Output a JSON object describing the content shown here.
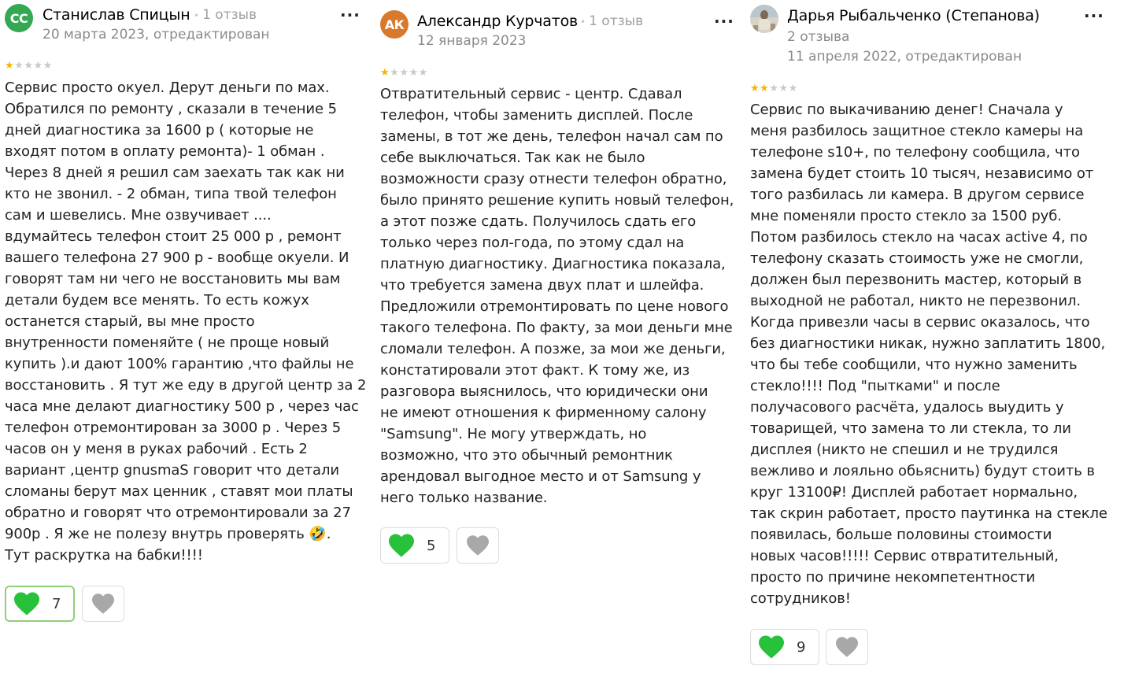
{
  "colors": {
    "heart_active": "#27c13a",
    "heart_inactive": "#a8a8a8",
    "star_filled": "#f6b400",
    "star_empty": "#c9c9c9"
  },
  "reviews": [
    {
      "avatar_initials": "СС",
      "avatar_color": "#34a853",
      "author": "Станислав Спицын",
      "review_count": "1 отзыв",
      "date": "20 марта 2023, отредактирован",
      "rating": 1,
      "text": "Сервис просто окуел. Дерут деньги по мах.\nОбратился по ремонту , сказали в течение 5\nдней диагностика за 1600 р ( которые не\nвходят потом в оплату ремонта)- 1 обман .\nЧерез 8 дней я решил сам заехать так как ни\nкто не звонил. - 2 обман, типа твой телефон\nсам и шевелись. Мне озвучивает ....\nвдумайтесь телефон стоит 25 000 р , ремонт\nвашего телефона 27 900 р - вообще окуели. И\nговорят там ни чего не восстановить мы вам\nдетали будем все менять. То есть кожух\nостанется старый, вы мне просто\nвнутренности поменяйте ( не проще новый\nкупить ).и дают 100% гарантию ,что файлы не\nвосстановить . Я тут же еду в другой центр за 2\nчаса мне делают диагностику 500 р , через час\nтелефон отремонтирован за 3000 р . Через 5\nчасов он у меня в руках рабочий . Есть 2\nвариант ,центр gnusmaS говорит что детали\nсломаны берут мах ценник , ставят мои платы\nобратно и говорят что отремонтировали за 27\n900р . Я же не полезу внутрь проверять 🤣.\nТут раскрутка на бабки!!!!",
      "likes": "7"
    },
    {
      "avatar_initials": "АК",
      "avatar_color": "#d9792b",
      "author": "Александр Курчатов",
      "review_count": "1 отзыв",
      "date": "12 января 2023",
      "rating": 1,
      "text": "Отвратительный сервис - центр. Сдавал\nтелефон, чтобы заменить дисплей. После\nзамены, в тот же день, телефон начал сам по\nсебе выключаться. Так как не было\nвозможности сразу отнести телефон обратно,\nбыло принято решение купить новый телефон,\nа этот позже сдать. Получилось сдать его\nтолько через пол-года, по этому сдал на\nплатную диагностику. Диагностика показала,\nчто требуется замена двух плат и шлейфа.\nПредложили отремонтировать по цене нового\nтакого телефона. По факту, за мои деньги мне\nсломали телефон. А позже, за мои же деньги,\nконстатировали этот факт. К тому же, из\nразговора выяснилось, что юридически они\nне имеют отношения к фирменному салону\n\"Samsung\". Не могу утверждать, но\nвозможно, что это обычный ремонтник\nарендовал выгодное место и от Samsung у\nнего только название.",
      "likes": "5"
    },
    {
      "author": "Дарья Рыбальченко (Степанова)",
      "review_count": "2 отзыва",
      "date": "11 апреля 2022, отредактирован",
      "rating": 2,
      "text": "Сервис по выкачиванию денег! Сначала у\nменя разбилось защитное стекло камеры на\nтелефоне s10+, по телефону сообщила, что\nзамена будет стоить 10 тысяч, независимо от\nтого разбилась ли камера. В другом сервисе\nмне поменяли просто стекло за 1500 руб.\nПотом разбилось стекло на часах active 4, по\nтелефону сказать стоимость уже не смогли,\nдолжен был перезвонить мастер, который в\nвыходной не работал, никто не перезвонил.\nКогда привезли часы в сервис оказалось, что\nбез диагностики никак, нужно заплатить 1800,\nчто бы тебе сообщили, что нужно заменить\nстекло!!!! Под \"пытками\" и после\nполучасового расчёта, удалось выудить у\nтоварищей, что замена то ли стекла, то ли\nдисплея (никто не спешил и не трудился\nвежливо и лояльно обьяснить) будут стоить в\nкруг 13100₽! Дисплей работает нормально,\nтак скрин работает, просто паутинка на стекле\nпоявилась, больше половины стоимости\nновых часов!!!!! Сервис отвратительный,\nпросто по причине некомпетентности\nсотрудников!",
      "likes": "9"
    }
  ]
}
